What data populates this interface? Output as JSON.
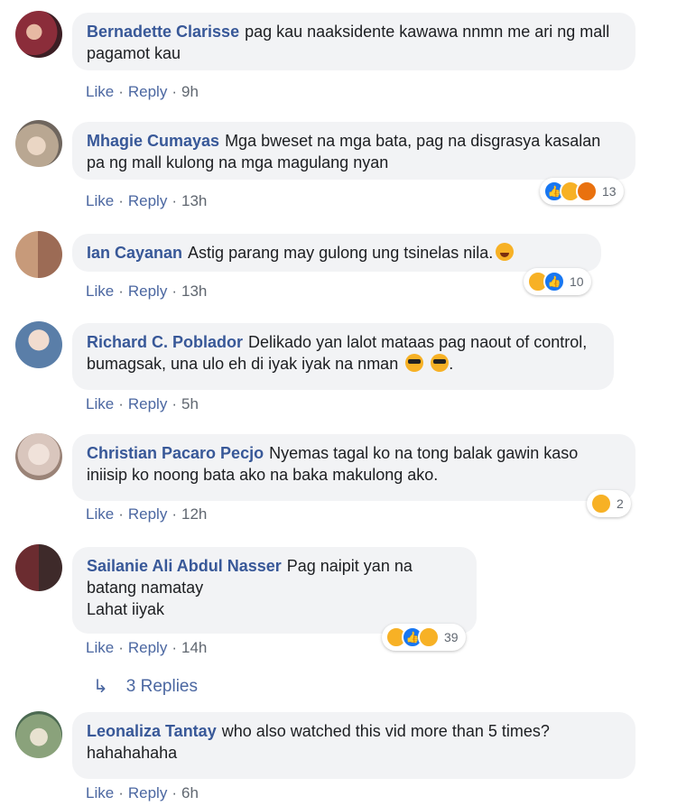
{
  "comments": [
    {
      "author": "Bernadette Clarisse",
      "text": "pag kau naaksidente kawawa nnmn me ari ng mall pagamot kau",
      "actions": {
        "like": "Like",
        "reply": "Reply",
        "time": "9h"
      },
      "avatar_color": "#8b2d3a"
    },
    {
      "author": "Mhagie Cumayas",
      "text": "Mga bweset na mga bata, pag na disgrasya kasalan pa ng mall kulong na mga magulang nyan",
      "actions": {
        "like": "Like",
        "reply": "Reply",
        "time": "13h"
      },
      "reactions": {
        "icons": [
          "like-icon",
          "haha-icon",
          "angry-icon"
        ],
        "count": "13"
      },
      "avatar_color": "#b9a792"
    },
    {
      "author": "Ian Cayanan",
      "text": "Astig parang may gulong ung tsinelas nila.",
      "actions": {
        "like": "Like",
        "reply": "Reply",
        "time": "13h"
      },
      "reactions": {
        "icons": [
          "haha-icon",
          "like-icon"
        ],
        "count": "10"
      },
      "avatar_color": "#c79a7a"
    },
    {
      "author": "Richard C. Poblador",
      "text": "Delikado yan lalot mataas pag naout of control, bumagsak, una ulo eh di iyak iyak na nman",
      "actions": {
        "like": "Like",
        "reply": "Reply",
        "time": "5h"
      },
      "avatar_color": "#5a7ea8"
    },
    {
      "author": "Christian Pacaro Pecjo",
      "text": "Nyemas tagal ko na tong balak gawin kaso iniisip ko noong bata ako na baka makulong ako.",
      "actions": {
        "like": "Like",
        "reply": "Reply",
        "time": "12h"
      },
      "reactions": {
        "icons": [
          "haha-icon"
        ],
        "count": "2"
      },
      "avatar_color": "#d9c6bd"
    },
    {
      "author": "Sailanie Ali Abdul Nasser",
      "text_lines": [
        "Pag naipit yan na",
        "batang namatay",
        "Lahat iiyak"
      ],
      "actions": {
        "like": "Like",
        "reply": "Reply",
        "time": "14h"
      },
      "reactions": {
        "icons": [
          "haha-icon",
          "like-icon",
          "sad-icon"
        ],
        "count": "39"
      },
      "avatar_color": "#6b2c30"
    },
    {
      "author": "Leonaliza Tantay",
      "text": "who also watched this vid more than 5 times? hahahahaha",
      "actions": {
        "like": "Like",
        "reply": "Reply",
        "time": "6h"
      },
      "avatar_color": "#8aa27b"
    }
  ],
  "replies_link": {
    "label": "3 Replies",
    "icon": "reply-arrow-icon"
  },
  "colors": {
    "link": "#385898",
    "bubble": "#f2f3f5",
    "like": "#1877f2",
    "haha": "#f7b125"
  }
}
